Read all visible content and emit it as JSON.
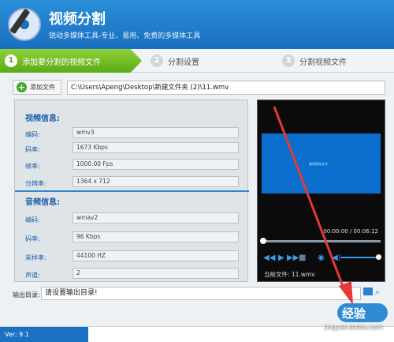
{
  "app": {
    "title": "视频分割",
    "subtitle": "锐动多媒体工具-专业、易用、免费的多媒体工具"
  },
  "steps": [
    {
      "num": "1",
      "label": "添加要分割的视频文件"
    },
    {
      "num": "2",
      "label": "分割设置"
    },
    {
      "num": "3",
      "label": "分割视频文件"
    }
  ],
  "file": {
    "add_button": "添加文件",
    "path": "C:\\Users\\Apeng\\Desktop\\新建文件夹 (2)\\11.wmv"
  },
  "video_info": {
    "heading": "视频信息:",
    "rows": [
      {
        "label": "编码:",
        "value": "wmv3"
      },
      {
        "label": "码率:",
        "value": "1673 Kbps"
      },
      {
        "label": "帧率:",
        "value": "1000.00 Fps"
      },
      {
        "label": "分辨率:",
        "value": "1364 x 712"
      }
    ]
  },
  "audio_info": {
    "heading": "音频信息:",
    "rows": [
      {
        "label": "编码:",
        "value": "wmav2"
      },
      {
        "label": "码率:",
        "value": "96 Kbps"
      },
      {
        "label": "采样率:",
        "value": "44100 HZ"
      },
      {
        "label": "声道:",
        "value": "2"
      }
    ]
  },
  "player": {
    "time": "00:00:00 / 00:06:12",
    "current_file": "当前文件: 11.wmv",
    "screen_text": "视频预览文字"
  },
  "output": {
    "label": "输出目录:",
    "value": "请设置输出目录!"
  },
  "footer": {
    "version": "Ver: 9.1"
  },
  "watermark": {
    "brand": "经验",
    "url": "jingyan.baidu.com"
  },
  "colors": {
    "header": "#1a6fbf",
    "step_active": "#5aab14",
    "accent": "#2e86d0",
    "arrow": "#e53935"
  }
}
